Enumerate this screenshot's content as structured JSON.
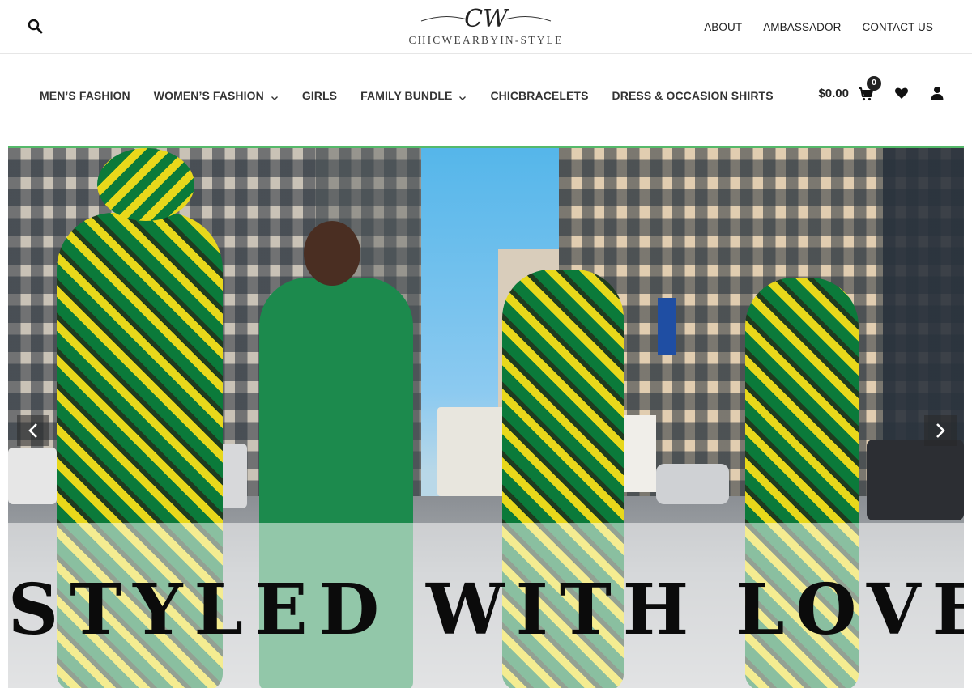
{
  "header": {
    "logo_monogram": "CW",
    "logo_text": "CHICWEARBYIN-STYLE",
    "top_links": [
      "ABOUT",
      "AMBASSADOR",
      "CONTACT US"
    ]
  },
  "nav": {
    "items": [
      {
        "label": "MEN’S FASHION",
        "has_dropdown": false
      },
      {
        "label": "WOMEN’S FASHION",
        "has_dropdown": true
      },
      {
        "label": "GIRLS",
        "has_dropdown": false
      },
      {
        "label": "FAMILY BUNDLE",
        "has_dropdown": true
      },
      {
        "label": "CHICBRACELETS",
        "has_dropdown": false
      },
      {
        "label": "DRESS & OCCASION SHIRTS",
        "has_dropdown": false
      }
    ],
    "cart_total": "$0.00",
    "cart_count": "0"
  },
  "hero": {
    "headline": "STYLED WITH LOVE",
    "icons": [
      "chevron-left-icon",
      "chevron-right-icon"
    ],
    "accent_color": "#55b96a"
  },
  "icons": [
    "search-icon",
    "cart-icon",
    "heart-icon",
    "user-icon",
    "chevron-down-icon"
  ]
}
